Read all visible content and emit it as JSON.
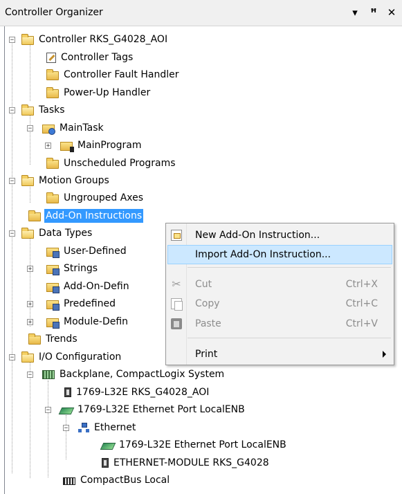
{
  "panel": {
    "title": "Controller Organizer",
    "menu_glyph": "▾",
    "pin_glyph": "ꟸ",
    "close_glyph": "✕"
  },
  "tree": {
    "controller": "Controller RKS_G4028_AOI",
    "controller_tags": "Controller Tags",
    "fault_handler": "Controller Fault Handler",
    "powerup_handler": "Power-Up Handler",
    "tasks": "Tasks",
    "main_task": "MainTask",
    "main_program": "MainProgram",
    "unscheduled": "Unscheduled Programs",
    "motion_groups": "Motion Groups",
    "ungrouped_axes": "Ungrouped Axes",
    "aoi": "Add-On Instructions",
    "data_types": "Data Types",
    "user_defined": "User-Defined",
    "strings": "Strings",
    "add_on_defined": "Add-On-Defin",
    "predefined": "Predefined",
    "module_defined": "Module-Defin",
    "trends": "Trends",
    "io_config": "I/O Configuration",
    "backplane": "Backplane, CompactLogix System",
    "l32e": "1769-L32E RKS_G4028_AOI",
    "eth_port": "1769-L32E Ethernet Port LocalENB",
    "ethernet": "Ethernet",
    "eth_port2": "1769-L32E Ethernet Port LocalENB",
    "eth_module": "ETHERNET-MODULE RKS_G4028",
    "compactbus": "CompactBus Local"
  },
  "context_menu": {
    "new_aoi": "New Add-On Instruction...",
    "import_aoi": "Import Add-On Instruction...",
    "cut": "Cut",
    "cut_sc": "Ctrl+X",
    "copy": "Copy",
    "copy_sc": "Ctrl+C",
    "paste": "Paste",
    "paste_sc": "Ctrl+V",
    "print": "Print"
  }
}
